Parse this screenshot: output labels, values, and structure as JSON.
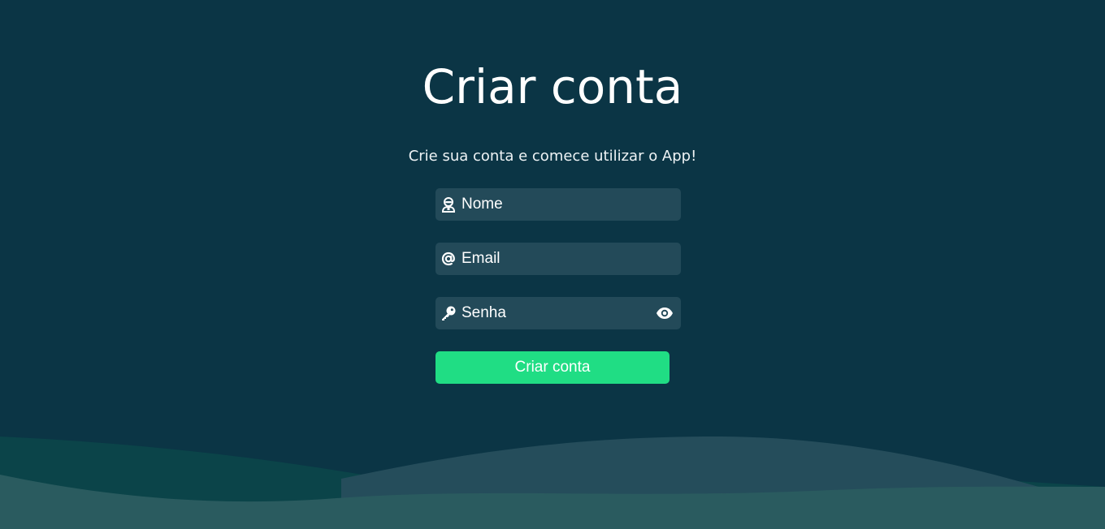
{
  "header": {
    "title": "Criar conta",
    "subtitle": "Crie sua conta e comece utilizar o App!"
  },
  "form": {
    "name": {
      "placeholder": "Nome",
      "icon": "user-icon"
    },
    "email": {
      "placeholder": "Email",
      "icon": "at-sign-icon"
    },
    "password": {
      "placeholder": "Senha",
      "icon": "key-icon",
      "toggle_icon": "eye-icon"
    },
    "submit_label": "Criar conta"
  },
  "colors": {
    "background": "#0b3545",
    "input_background": "#234a59",
    "button": "#20dd84",
    "wave_back": "#0b4449",
    "wave_mid": "#254d5b",
    "wave_front": "#2a5b5f"
  }
}
